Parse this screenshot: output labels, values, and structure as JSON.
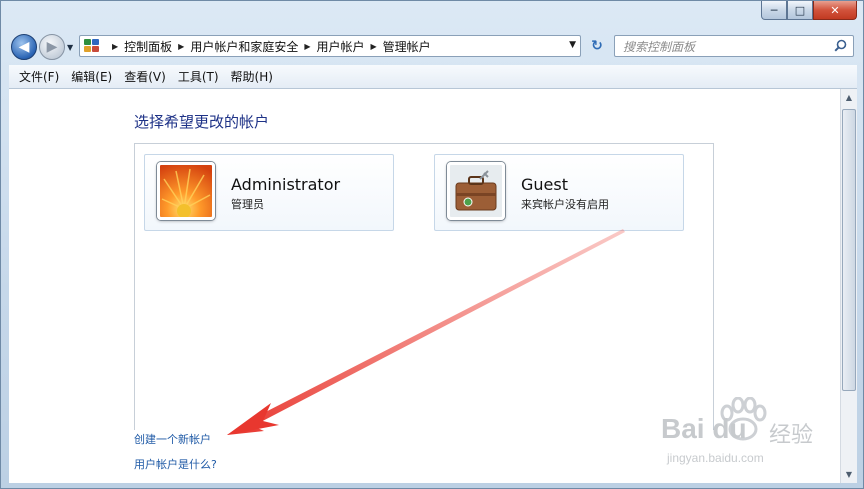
{
  "window": {
    "minimize": "─",
    "maximize": "□",
    "close": "✕"
  },
  "nav": {
    "back_label": "◀",
    "forward_label": "▶",
    "dropdown": "▼"
  },
  "address": {
    "crumbs": [
      "控制面板",
      "用户帐户和家庭安全",
      "用户帐户",
      "管理帐户"
    ],
    "separator": "▶",
    "dropdown": "▼"
  },
  "refresh_label": "↻",
  "search": {
    "placeholder": "搜索控制面板"
  },
  "menu": [
    "文件(F)",
    "编辑(E)",
    "查看(V)",
    "工具(T)",
    "帮助(H)"
  ],
  "main": {
    "heading": "选择希望更改的帐户",
    "accounts": [
      {
        "name": "Administrator",
        "type": "管理员",
        "picture": "orange-flower"
      },
      {
        "name": "Guest",
        "type": "来宾帐户没有启用",
        "picture": "briefcase"
      }
    ],
    "links": {
      "create": "创建一个新帐户",
      "what": "用户帐户是什么?"
    }
  },
  "watermark": {
    "brand": "Bai du",
    "suffix": "经验",
    "url": "jingyan.baidu.com"
  },
  "colors": {
    "link": "#1f5aa6",
    "heading": "#1e3287",
    "annotation_arrow": "#e8372f"
  }
}
